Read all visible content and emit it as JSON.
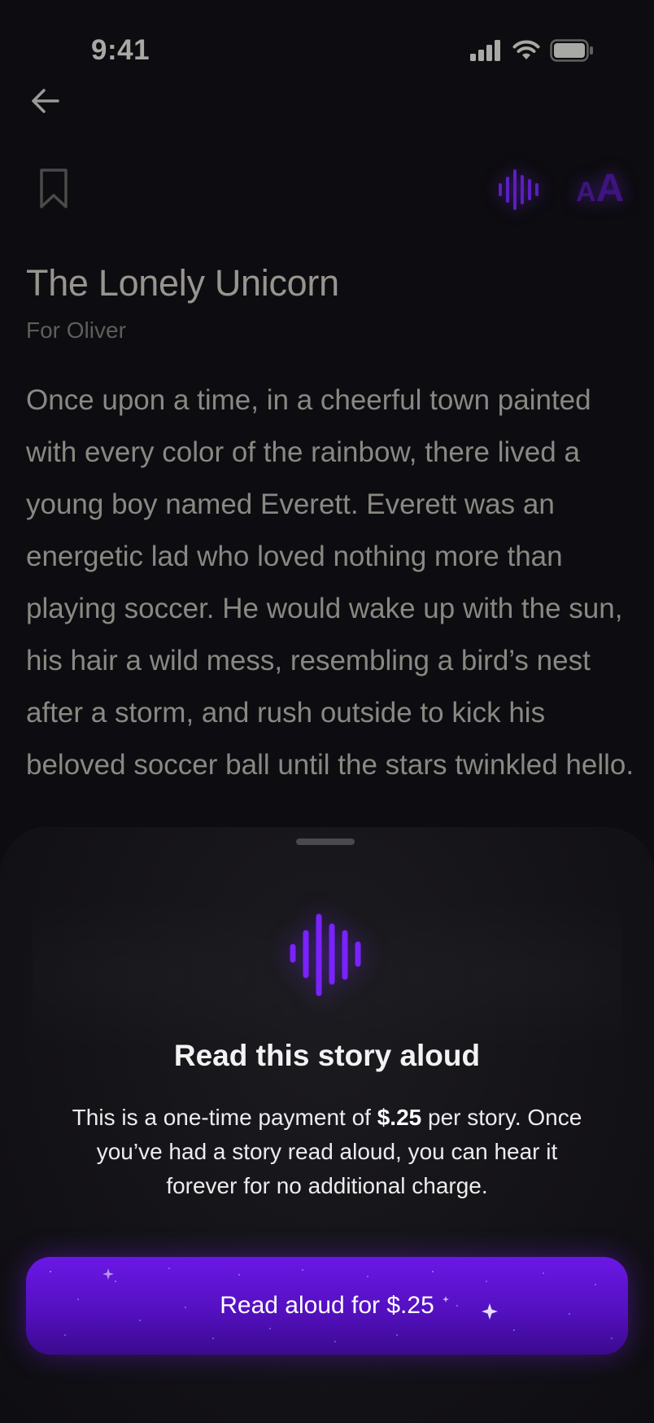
{
  "status_bar": {
    "time": "9:41"
  },
  "icons": {
    "back": "arrow-left-icon",
    "bookmark": "bookmark-icon",
    "audio": "sound-wave-icon",
    "font_size": "text-size-icon",
    "signal": "cellular-signal-icon",
    "wifi": "wifi-icon",
    "battery": "battery-icon"
  },
  "toolbar": {
    "font_small": "A",
    "font_large": "A"
  },
  "story": {
    "title": "The Lonely Unicorn",
    "subtitle": "For Oliver",
    "body": "Once upon a time, in a cheerful town painted with every color of the rainbow, there lived a young boy named Everett. Everett was an energetic lad who loved nothing more than playing soccer. He would wake up with the sun, his hair a wild mess, resembling a bird’s nest after a storm, and rush outside to kick his beloved soccer ball until the stars twinkled hello."
  },
  "sheet": {
    "title": "Read this story aloud",
    "desc_prefix": "This is a one-time payment of ",
    "desc_price": "$.25",
    "desc_suffix": " per story. Once you’ve had a story read aloud, you can hear it forever for no additional charge.",
    "cta_label": "Read aloud for $.25"
  },
  "colors": {
    "accent": "#6a18e6",
    "accent_dark": "#3c0a8e",
    "background": "#0d0c10"
  }
}
